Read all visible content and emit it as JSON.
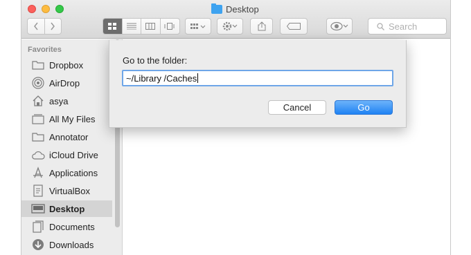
{
  "window": {
    "title": "Desktop",
    "colors": {
      "close": "#fc605c",
      "minimize": "#fdbc40",
      "maximize": "#34c84a",
      "folder_accent": "#3ea3f0"
    }
  },
  "toolbar": {
    "back_icon": "chevron-left-icon",
    "forward_icon": "chevron-right-icon",
    "view_modes": [
      "icon-view-icon",
      "list-view-icon",
      "column-view-icon",
      "coverflow-view-icon"
    ],
    "active_view": "icon-view-icon",
    "arrange_icon": "arrange-grid-icon",
    "action_icon": "gear-icon",
    "share_icon": "share-icon",
    "tag_icon": "tag-icon",
    "quicklook_icon": "eye-icon",
    "search_placeholder": "Search"
  },
  "sidebar": {
    "heading": "Favorites",
    "items": [
      {
        "label": "Dropbox",
        "icon": "folder-icon"
      },
      {
        "label": "AirDrop",
        "icon": "airdrop-icon"
      },
      {
        "label": "asya",
        "icon": "home-icon"
      },
      {
        "label": "All My Files",
        "icon": "all-files-icon"
      },
      {
        "label": "Annotator",
        "icon": "folder-icon"
      },
      {
        "label": "iCloud Drive",
        "icon": "cloud-icon"
      },
      {
        "label": "Applications",
        "icon": "applications-icon"
      },
      {
        "label": "VirtualBox",
        "icon": "document-icon"
      },
      {
        "label": "Desktop",
        "icon": "desktop-icon",
        "selected": true
      },
      {
        "label": "Documents",
        "icon": "documents-icon"
      },
      {
        "label": "Downloads",
        "icon": "downloads-icon"
      }
    ]
  },
  "dialog": {
    "label": "Go to the folder:",
    "input_value": "~/Library /Caches",
    "cancel_label": "Cancel",
    "go_label": "Go",
    "accent": "#1f82f3"
  }
}
